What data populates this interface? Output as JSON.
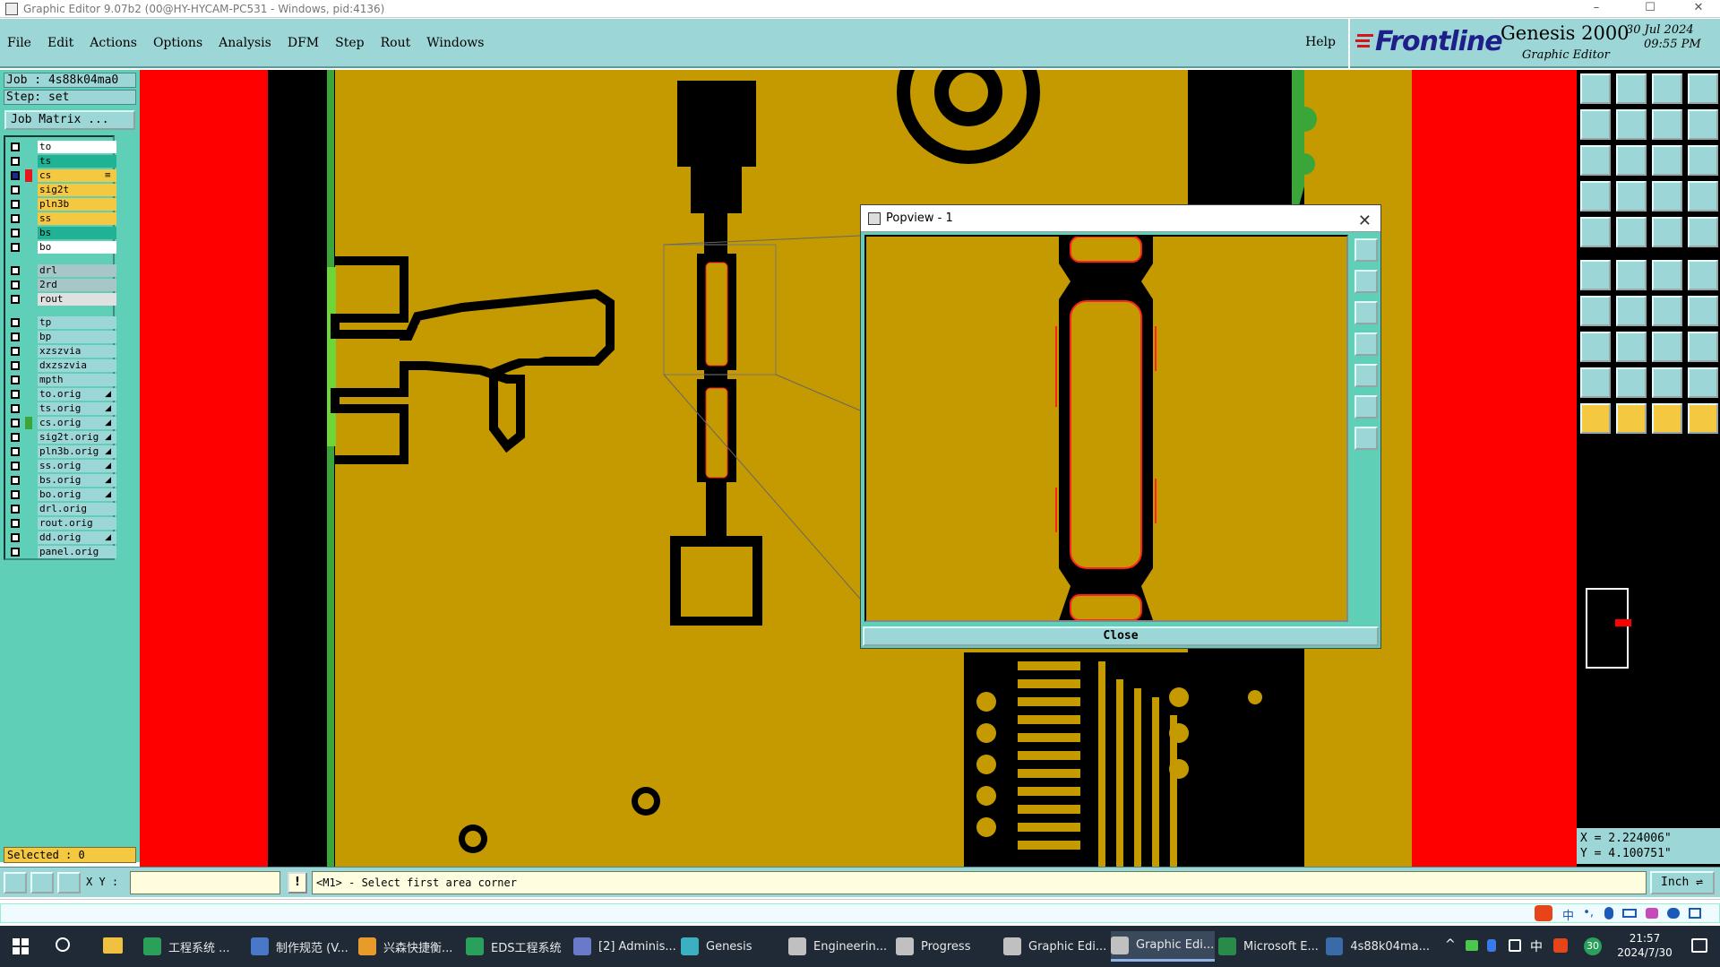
{
  "window": {
    "title": "Graphic Editor 9.07b2 (00@HY-HYCAM-PC531 - Windows, pid:4136)",
    "controls": [
      "–",
      "☐",
      "✕"
    ]
  },
  "menu": {
    "items": [
      "File",
      "Edit",
      "Actions",
      "Options",
      "Analysis",
      "DFM",
      "Step",
      "Rout",
      "Windows"
    ],
    "help": "Help"
  },
  "brand": {
    "logo": "Frontline",
    "product": "Genesis 2000",
    "subtitle": "Graphic Editor",
    "date": "30 Jul 2024",
    "time": "09:55 PM"
  },
  "job": {
    "job_label": "Job : 4s88k04ma0",
    "step_label": "Step: set",
    "matrix_button": "Job Matrix ..."
  },
  "layers": [
    {
      "name": "to",
      "bg": "#ffffff",
      "swatch": "",
      "checked": false,
      "arrow": ""
    },
    {
      "name": "ts",
      "bg": "#1fb294",
      "swatch": "",
      "checked": false,
      "arrow": ""
    },
    {
      "name": "cs",
      "bg": "#f5c842",
      "swatch": "#e8161a",
      "checked": true,
      "arrow": "≡"
    },
    {
      "name": "sig2t",
      "bg": "#f5c842",
      "swatch": "",
      "checked": false,
      "arrow": ""
    },
    {
      "name": "pln3b",
      "bg": "#f5c842",
      "swatch": "",
      "checked": false,
      "arrow": ""
    },
    {
      "name": "ss",
      "bg": "#f5c842",
      "swatch": "",
      "checked": false,
      "arrow": ""
    },
    {
      "name": "bs",
      "bg": "#1fb294",
      "swatch": "",
      "checked": false,
      "arrow": ""
    },
    {
      "name": "bo",
      "bg": "#ffffff",
      "swatch": "",
      "checked": false,
      "arrow": ""
    },
    {
      "name": "drl",
      "bg": "#a7c6c8",
      "swatch": "",
      "checked": false,
      "arrow": ""
    },
    {
      "name": "2rd",
      "bg": "#a7c6c8",
      "swatch": "",
      "checked": false,
      "arrow": ""
    },
    {
      "name": "rout",
      "bg": "#e0e0e0",
      "swatch": "",
      "checked": false,
      "arrow": ""
    },
    {
      "name": "tp",
      "bg": "#9dd6d6",
      "swatch": "",
      "checked": false,
      "arrow": ""
    },
    {
      "name": "bp",
      "bg": "#9dd6d6",
      "swatch": "",
      "checked": false,
      "arrow": ""
    },
    {
      "name": "xzszvia",
      "bg": "#9dd6d6",
      "swatch": "",
      "checked": false,
      "arrow": ""
    },
    {
      "name": "dxzszvia",
      "bg": "#9dd6d6",
      "swatch": "",
      "checked": false,
      "arrow": ""
    },
    {
      "name": "mpth",
      "bg": "#9dd6d6",
      "swatch": "",
      "checked": false,
      "arrow": ""
    },
    {
      "name": "to.orig",
      "bg": "#9dd6d6",
      "swatch": "",
      "checked": false,
      "arrow": "◢"
    },
    {
      "name": "ts.orig",
      "bg": "#9dd6d6",
      "swatch": "",
      "checked": false,
      "arrow": "◢"
    },
    {
      "name": "cs.orig",
      "bg": "#9dd6d6",
      "swatch": "#3aa63a",
      "checked": false,
      "arrow": "◢"
    },
    {
      "name": "sig2t.orig",
      "bg": "#9dd6d6",
      "swatch": "",
      "checked": false,
      "arrow": "◢"
    },
    {
      "name": "pln3b.orig",
      "bg": "#9dd6d6",
      "swatch": "",
      "checked": false,
      "arrow": "◢"
    },
    {
      "name": "ss.orig",
      "bg": "#9dd6d6",
      "swatch": "",
      "checked": false,
      "arrow": "◢"
    },
    {
      "name": "bs.orig",
      "bg": "#9dd6d6",
      "swatch": "",
      "checked": false,
      "arrow": "◢"
    },
    {
      "name": "bo.orig",
      "bg": "#9dd6d6",
      "swatch": "",
      "checked": false,
      "arrow": "◢"
    },
    {
      "name": "drl.orig",
      "bg": "#9dd6d6",
      "swatch": "",
      "checked": false,
      "arrow": ""
    },
    {
      "name": "rout.orig",
      "bg": "#9dd6d6",
      "swatch": "",
      "checked": false,
      "arrow": ""
    },
    {
      "name": "dd.orig",
      "bg": "#9dd6d6",
      "swatch": "",
      "checked": false,
      "arrow": "◢"
    },
    {
      "name": "panel.orig",
      "bg": "#9dd6d6",
      "swatch": "",
      "checked": false,
      "arrow": ""
    }
  ],
  "selected_label": "Selected : 0",
  "popview": {
    "title": "Popview - 1",
    "close_button": "Close"
  },
  "coords": {
    "x": "X = 2.224006\"",
    "y": "Y = 4.100751\""
  },
  "bottom": {
    "xy_label": "X Y :",
    "xy_value": "",
    "excl": "!",
    "prompt": "<M1> - Select first area corner",
    "units": "Inch ⇌"
  },
  "taskbar": {
    "items": [
      {
        "label": "工程系统 ...",
        "color": "#2aa05a"
      },
      {
        "label": "制作规范 (V...",
        "color": "#4a78c8"
      },
      {
        "label": "兴森快捷衡...",
        "color": "#e89a2a"
      },
      {
        "label": "EDS工程系统",
        "color": "#2aa05a"
      },
      {
        "label": "[2] Adminis...",
        "color": "#6a7ac8"
      },
      {
        "label": "Genesis",
        "color": "#3ab0c0"
      },
      {
        "label": "Engineerin...",
        "color": "#c0c0c0"
      },
      {
        "label": "Progress",
        "color": "#c0c0c0"
      },
      {
        "label": "Graphic Edi...",
        "color": "#c0c0c0"
      },
      {
        "label": "Graphic Edi...",
        "color": "#c0c0c0",
        "active": true
      },
      {
        "label": "Microsoft E...",
        "color": "#2a8a4a"
      },
      {
        "label": "4s88k04ma...",
        "color": "#3a6aa8"
      }
    ],
    "tray": [
      "^",
      "中",
      "30"
    ],
    "time": "21:57",
    "date": "2024/7/30"
  }
}
